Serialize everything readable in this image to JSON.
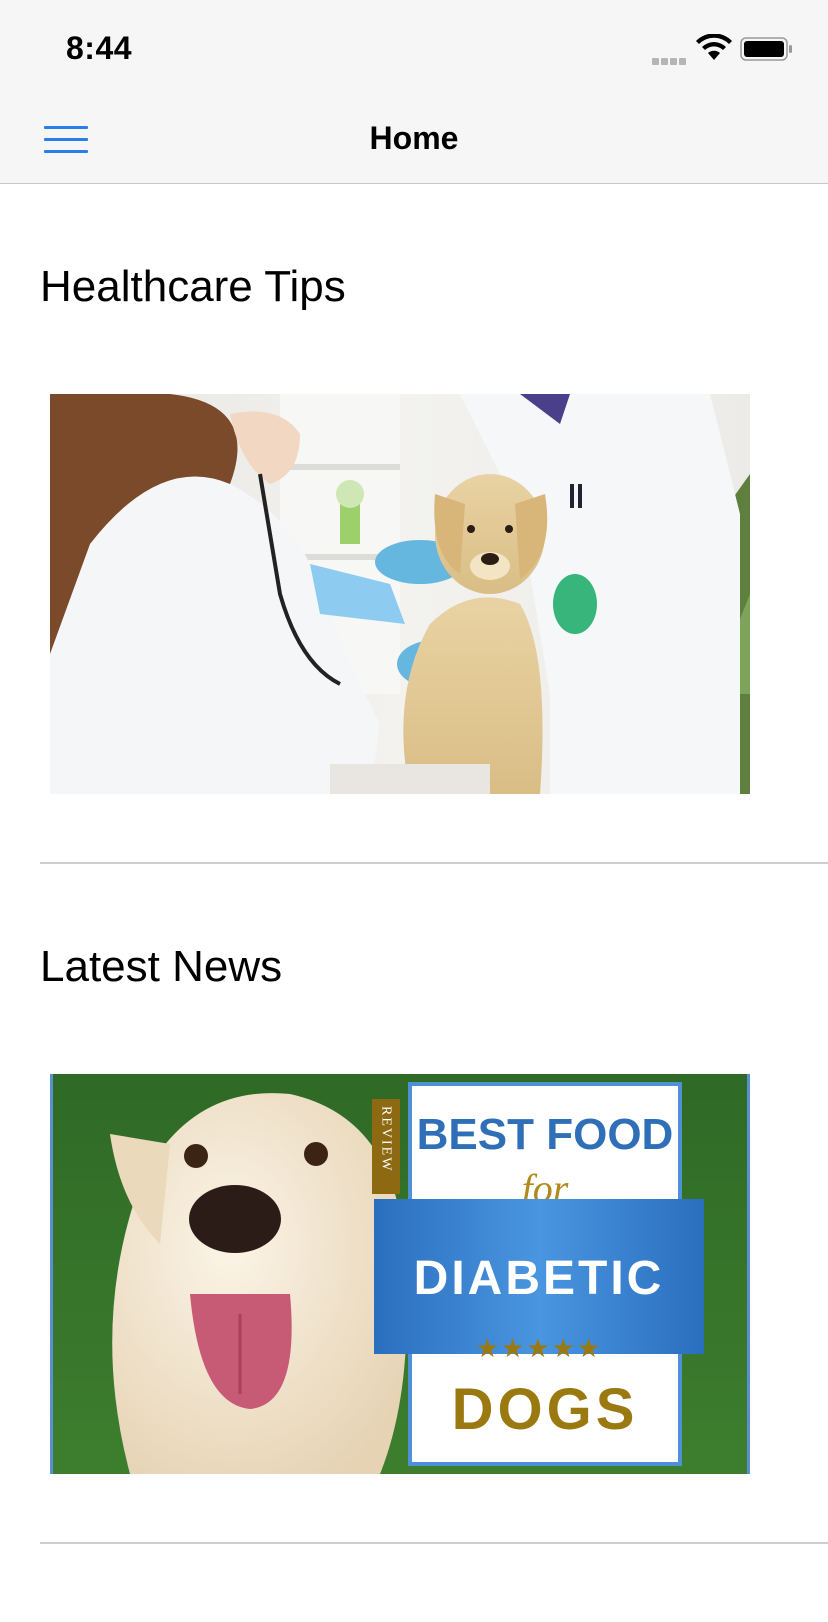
{
  "status": {
    "time": "8:44"
  },
  "nav": {
    "title": "Home"
  },
  "sections": [
    {
      "title": "Healthcare Tips"
    },
    {
      "title": "Latest News",
      "banner": {
        "line1": "BEST FOOD",
        "line2": "for",
        "line3": "DIABETIC",
        "line4": "DOGS",
        "tag": "REVIEW",
        "rating": "★★★★★"
      }
    }
  ],
  "colors": {
    "accent": "#2a7ee8",
    "banner_blue": "#2f7fd0",
    "banner_gold": "#9a7a10"
  }
}
